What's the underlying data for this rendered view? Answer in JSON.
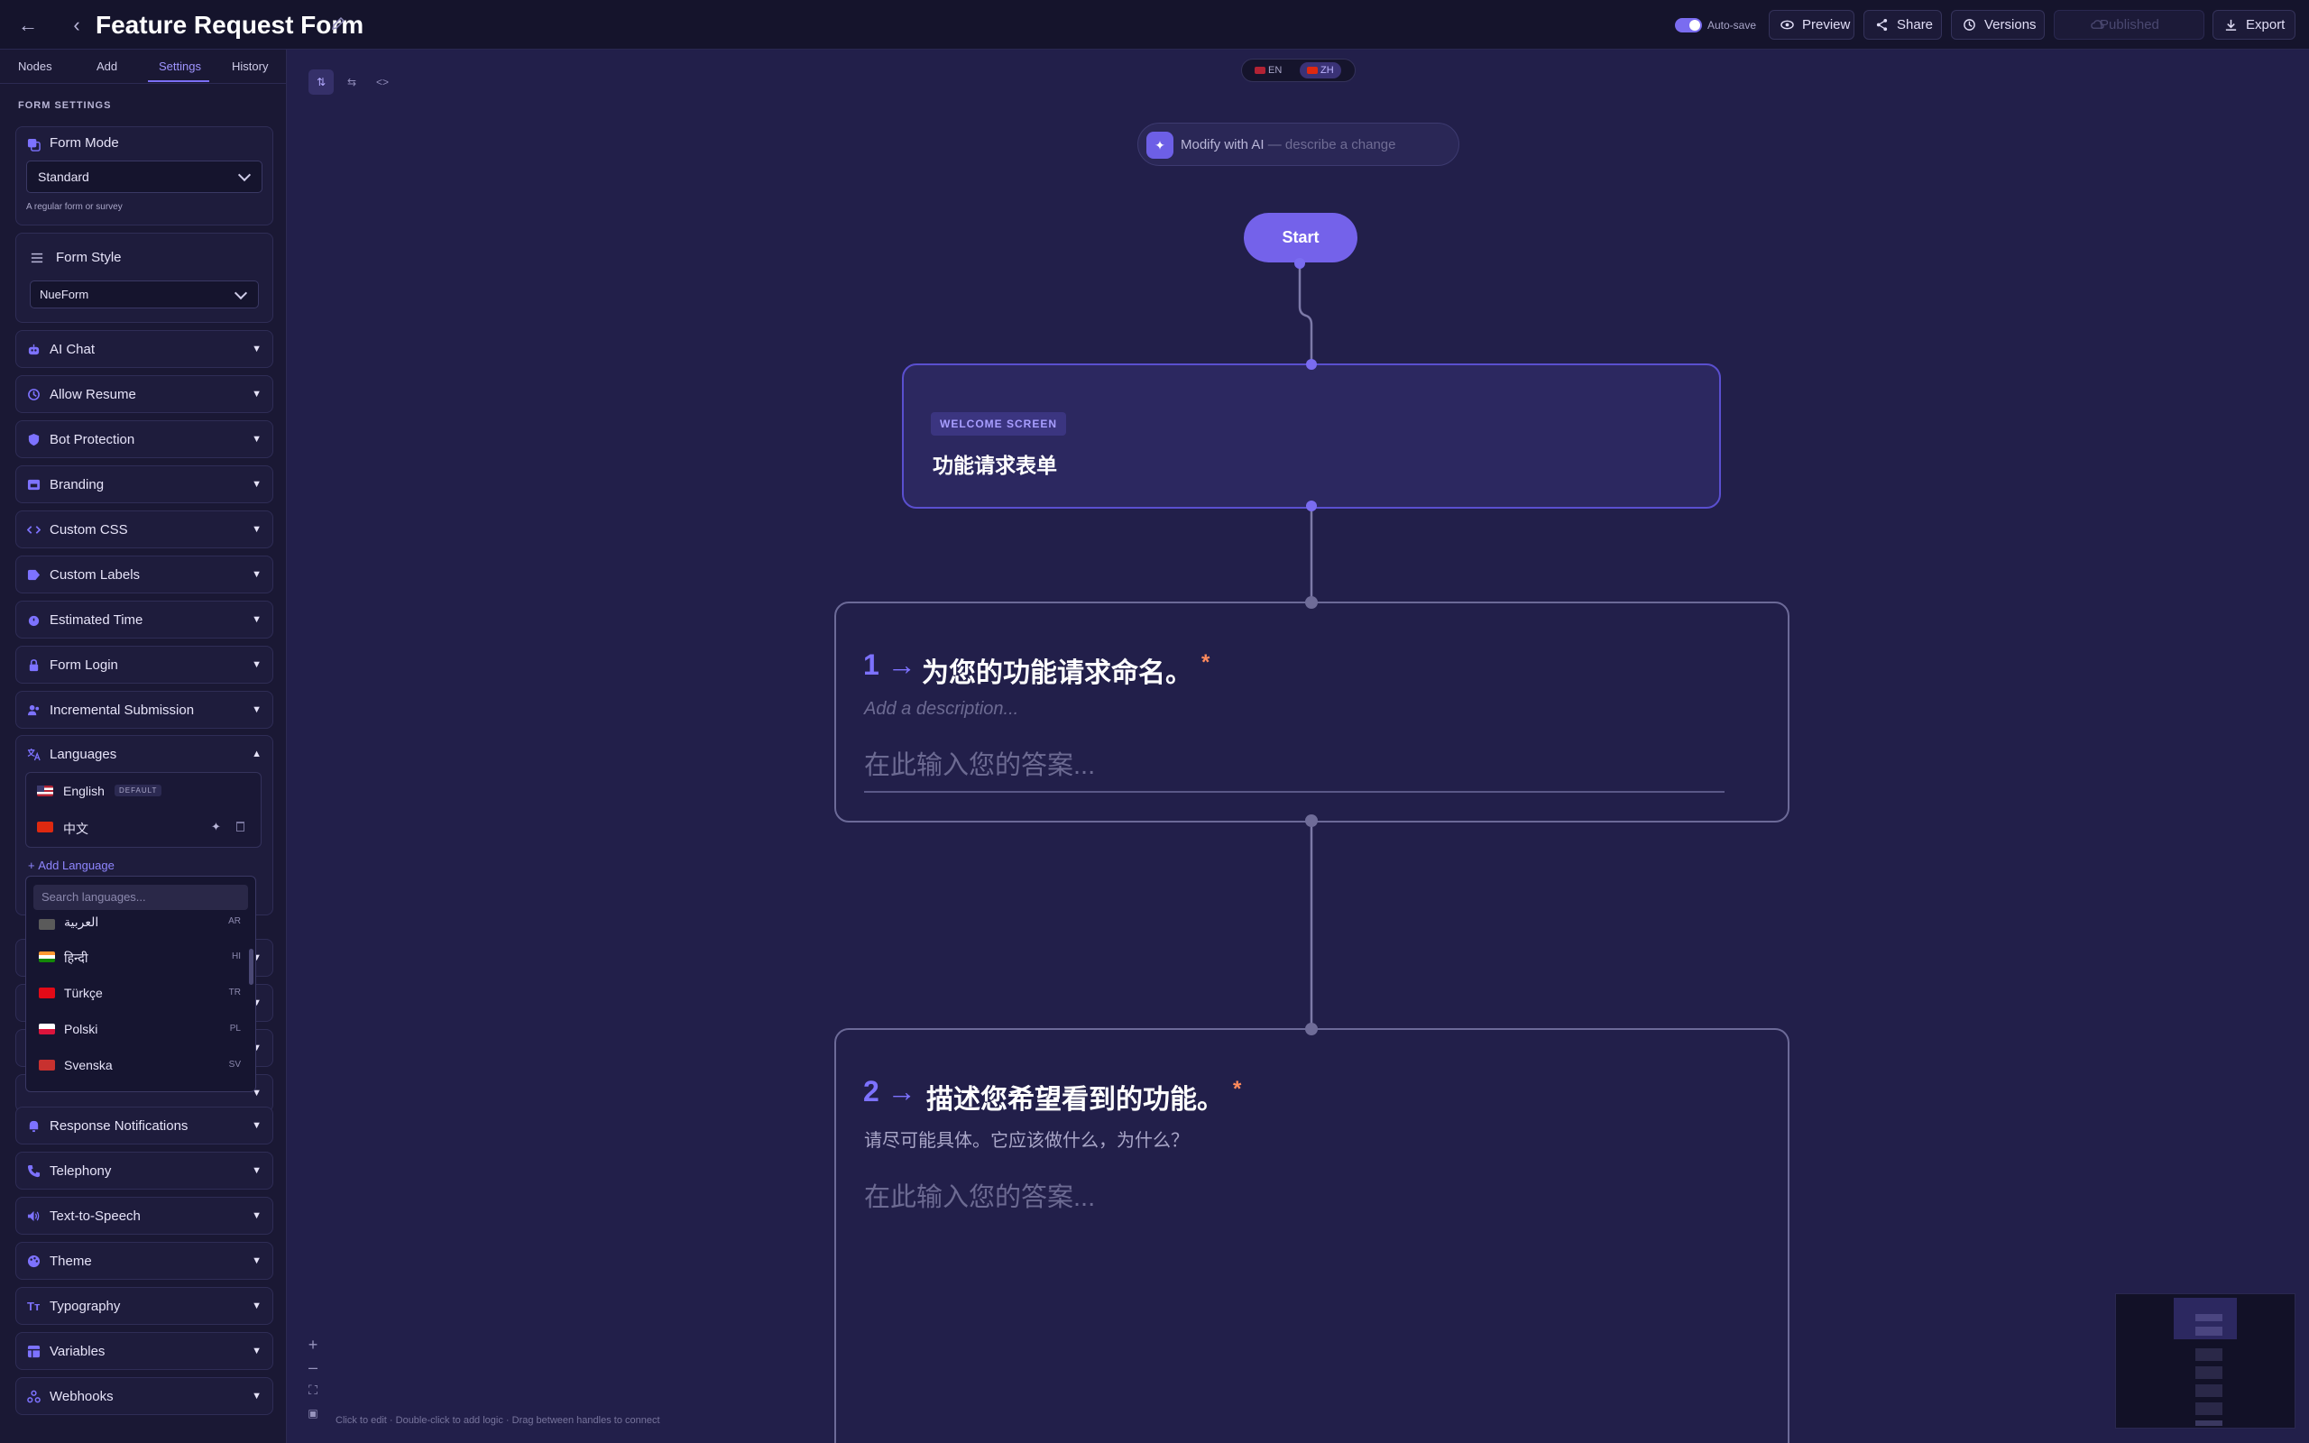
{
  "header": {
    "title": "Feature Request Form",
    "autosave_label": "Auto-save",
    "buttons": {
      "preview": "Preview",
      "share": "Share",
      "versions": "Versions",
      "published": "Published",
      "export": "Export"
    }
  },
  "sidebar": {
    "tabs": [
      "Nodes",
      "Add",
      "Settings",
      "History"
    ],
    "active_tab": "Settings",
    "section_title": "FORM SETTINGS",
    "form_mode": {
      "label": "Form Mode",
      "value": "Standard",
      "hint": "A regular form or survey"
    },
    "form_style": {
      "label": "Form Style",
      "value": "NueForm"
    },
    "accordions_top": [
      "AI Chat",
      "Allow Resume",
      "Bot Protection",
      "Branding",
      "Custom CSS",
      "Custom Labels",
      "Estimated Time",
      "Form Login",
      "Incremental Submission"
    ],
    "languages": {
      "label": "Languages",
      "list": [
        {
          "name": "English",
          "badge": "DEFAULT"
        },
        {
          "name": "中文"
        }
      ],
      "add_label": "Add Language",
      "search_placeholder": "Search languages...",
      "options": [
        {
          "name": "العربية",
          "code": "AR"
        },
        {
          "name": "हिन्दी",
          "code": "HI"
        },
        {
          "name": "Türkçe",
          "code": "TR"
        },
        {
          "name": "Polski",
          "code": "PL"
        },
        {
          "name": "Svenska",
          "code": "SV"
        }
      ]
    },
    "accordions_bottom": [
      "Response Notifications",
      "Telephony",
      "Text-to-Speech",
      "Theme",
      "Typography",
      "Variables",
      "Webhooks"
    ]
  },
  "canvas": {
    "lang_switch": [
      "EN",
      "ZH"
    ],
    "active_lang": "ZH",
    "ai_prompt": {
      "label": "Modify with AI",
      "placeholder": " — describe a change"
    },
    "start_label": "Start",
    "welcome": {
      "badge": "WELCOME SCREEN",
      "title": "功能请求表单"
    },
    "questions": [
      {
        "number": "1",
        "title": "为您的功能请求命名。",
        "required": "*",
        "description": "Add a description...",
        "answer_placeholder": "在此输入您的答案..."
      },
      {
        "number": "2",
        "title": "描述您希望看到的功能。",
        "required": "*",
        "description": "请尽可能具体。它应该做什么，为什么？",
        "answer_placeholder": "在此输入您的答案..."
      }
    ],
    "footer_hint": "Click to edit · Double-click to add logic · Drag between handles to connect"
  },
  "colors": {
    "accent": "#7462ea",
    "background": "#221f4a",
    "sidebar": "#1a1834",
    "required": "#ff8a5c"
  }
}
